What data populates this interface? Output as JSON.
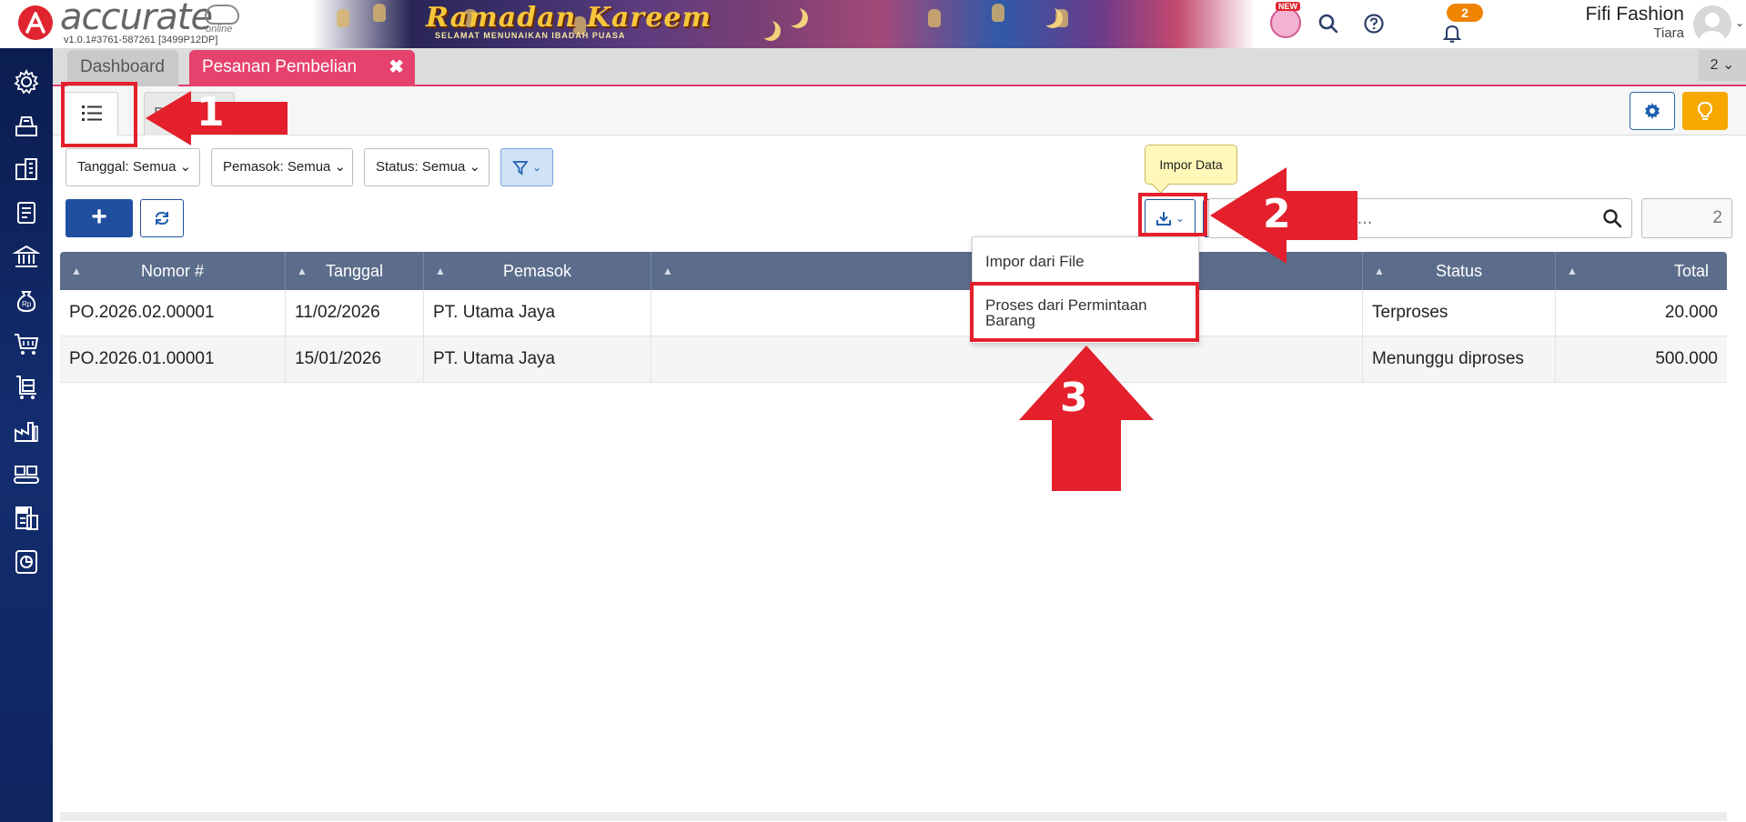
{
  "header": {
    "logo_text": "accurate",
    "logo_online": "online",
    "version": "v1.0.1#3761-587261 [3499P12DP]",
    "banner_title": "Ramadan Kareem",
    "banner_sub": "SELAMAT MENUNAIKAN IBADAH PUASA",
    "new_badge": "NEW",
    "notification_count": "2",
    "user_name": "Fifi Fashion",
    "user_sub": "Tiara"
  },
  "tabs": {
    "dashboard": "Dashboard",
    "active": "Pesanan Pembelian",
    "close": "✖",
    "count": "2 ⌄"
  },
  "view_tabs": {
    "detail_label": "D"
  },
  "filters": {
    "tanggal": "Tanggal: Semua ⌄",
    "pemasok": "Pemasok: Semua ⌄",
    "status": "Status: Semua ⌄"
  },
  "actions": {
    "add": "+",
    "tooltip": "Impor Data",
    "search_placeholder": "Cari...",
    "count_value": "2"
  },
  "menu": {
    "items": [
      "Impor dari File",
      "Proses dari Permintaan Barang"
    ]
  },
  "table": {
    "columns": [
      "Nomor #",
      "Tanggal",
      "Pemasok",
      "",
      "Status",
      "Total"
    ],
    "rows": [
      {
        "nomor": "PO.2026.02.00001",
        "tanggal": "11/02/2026",
        "pemasok": "PT. Utama Jaya",
        "status": "Terproses",
        "total": "20.000"
      },
      {
        "nomor": "PO.2026.01.00001",
        "tanggal": "15/01/2026",
        "pemasok": "PT. Utama Jaya",
        "status": "Menunggu diproses",
        "total": "500.000"
      }
    ]
  },
  "annotations": {
    "step1": "1",
    "step2": "2",
    "step3": "3"
  },
  "colors": {
    "accent_tab": "#e6426e",
    "primary": "#1f4f9e",
    "table_header": "#5b6d8b",
    "annotation": "#e3202c",
    "sidebar": "#0b1d4f"
  },
  "icons": {
    "sidebar": [
      "gear-icon",
      "cash-register-icon",
      "building-icon",
      "ledger-book-icon",
      "bank-icon",
      "money-bag-icon",
      "shopping-cart-icon",
      "warehouse-cart-icon",
      "factory-icon",
      "conveyor-icon",
      "tax-document-icon",
      "report-chart-icon"
    ]
  }
}
